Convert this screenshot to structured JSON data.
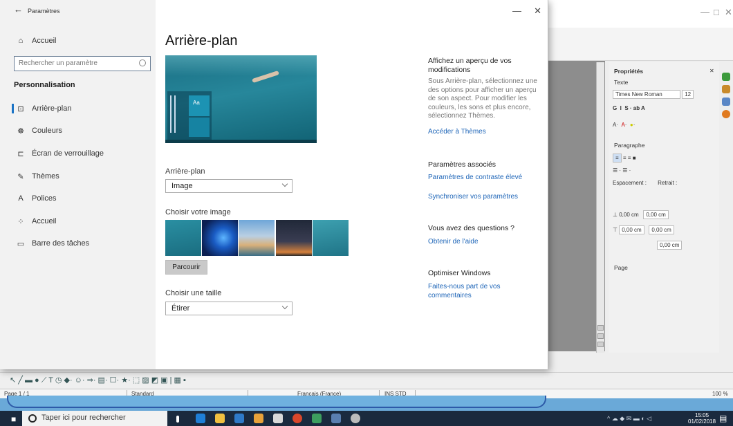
{
  "settings": {
    "titlebar": {
      "back": "←",
      "title": "Paramètres"
    },
    "nav": {
      "home": "Accueil",
      "search_placeholder": "Rechercher un paramètre",
      "category": "Personnalisation",
      "items": [
        {
          "label": "Arrière-plan",
          "icon": "picture-icon",
          "glyph": "⊡"
        },
        {
          "label": "Couleurs",
          "icon": "palette-icon",
          "glyph": "☸"
        },
        {
          "label": "Écran de verrouillage",
          "icon": "lockscreen-icon",
          "glyph": "⊏"
        },
        {
          "label": "Thèmes",
          "icon": "brush-icon",
          "glyph": "✎"
        },
        {
          "label": "Polices",
          "icon": "font-icon",
          "glyph": "A"
        },
        {
          "label": "Accueil",
          "icon": "start-icon",
          "glyph": "⁘"
        },
        {
          "label": "Barre des tâches",
          "icon": "taskbar-icon",
          "glyph": "▭"
        }
      ]
    },
    "main": {
      "title": "Arrière-plan",
      "preview_sample": "Aa",
      "background_label": "Arrière-plan",
      "background_value": "Image",
      "choose_image_label": "Choisir votre image",
      "browse_label": "Parcourir",
      "fit_label": "Choisir une taille",
      "fit_value": "Étirer"
    },
    "right": {
      "preview_heading": "Affichez un aperçu de vos modifications",
      "preview_desc": "Sous Arrière-plan, sélectionnez une des options pour afficher un aperçu de son aspect. Pour modifier les couleurs, les sons et plus encore, sélectionnez Thèmes.",
      "themes_link": "Accéder à Thèmes",
      "related_heading": "Paramètres associés",
      "contrast_link": "Paramètres de contraste élevé",
      "sync_link": "Synchroniser vos paramètres",
      "questions_heading": "Vous avez des questions ?",
      "help_link": "Obtenir de l'aide",
      "improve_heading": "Optimiser Windows",
      "feedback_link": "Faites-nous part de vos commentaires"
    },
    "window_controls": {
      "minimize": "—",
      "close": "✕"
    }
  },
  "libreoffice": {
    "sidebar": {
      "title": "Propriétés",
      "text_section": "Texte",
      "font_name": "Times New Roman",
      "font_size": "12",
      "paragraph_section": "Paragraphe",
      "spacing_label": "Espacement :",
      "indent_label": "Retrait :",
      "spacing_above": "0,00 cm",
      "spacing_below": "0,00 cm",
      "indent_before": "0,00 cm",
      "indent_after": "0,00 cm",
      "indent_first": "0,00 cm",
      "page_section": "Page"
    },
    "statusbar": {
      "page": "Page 1 / 1",
      "style": "Standard",
      "language": "Français (France)",
      "mode": "INS STD",
      "zoom": "100 %"
    }
  },
  "taskbar": {
    "search_placeholder": "Taper ici pour rechercher",
    "time": "15:05",
    "date": "01/02/2018"
  }
}
